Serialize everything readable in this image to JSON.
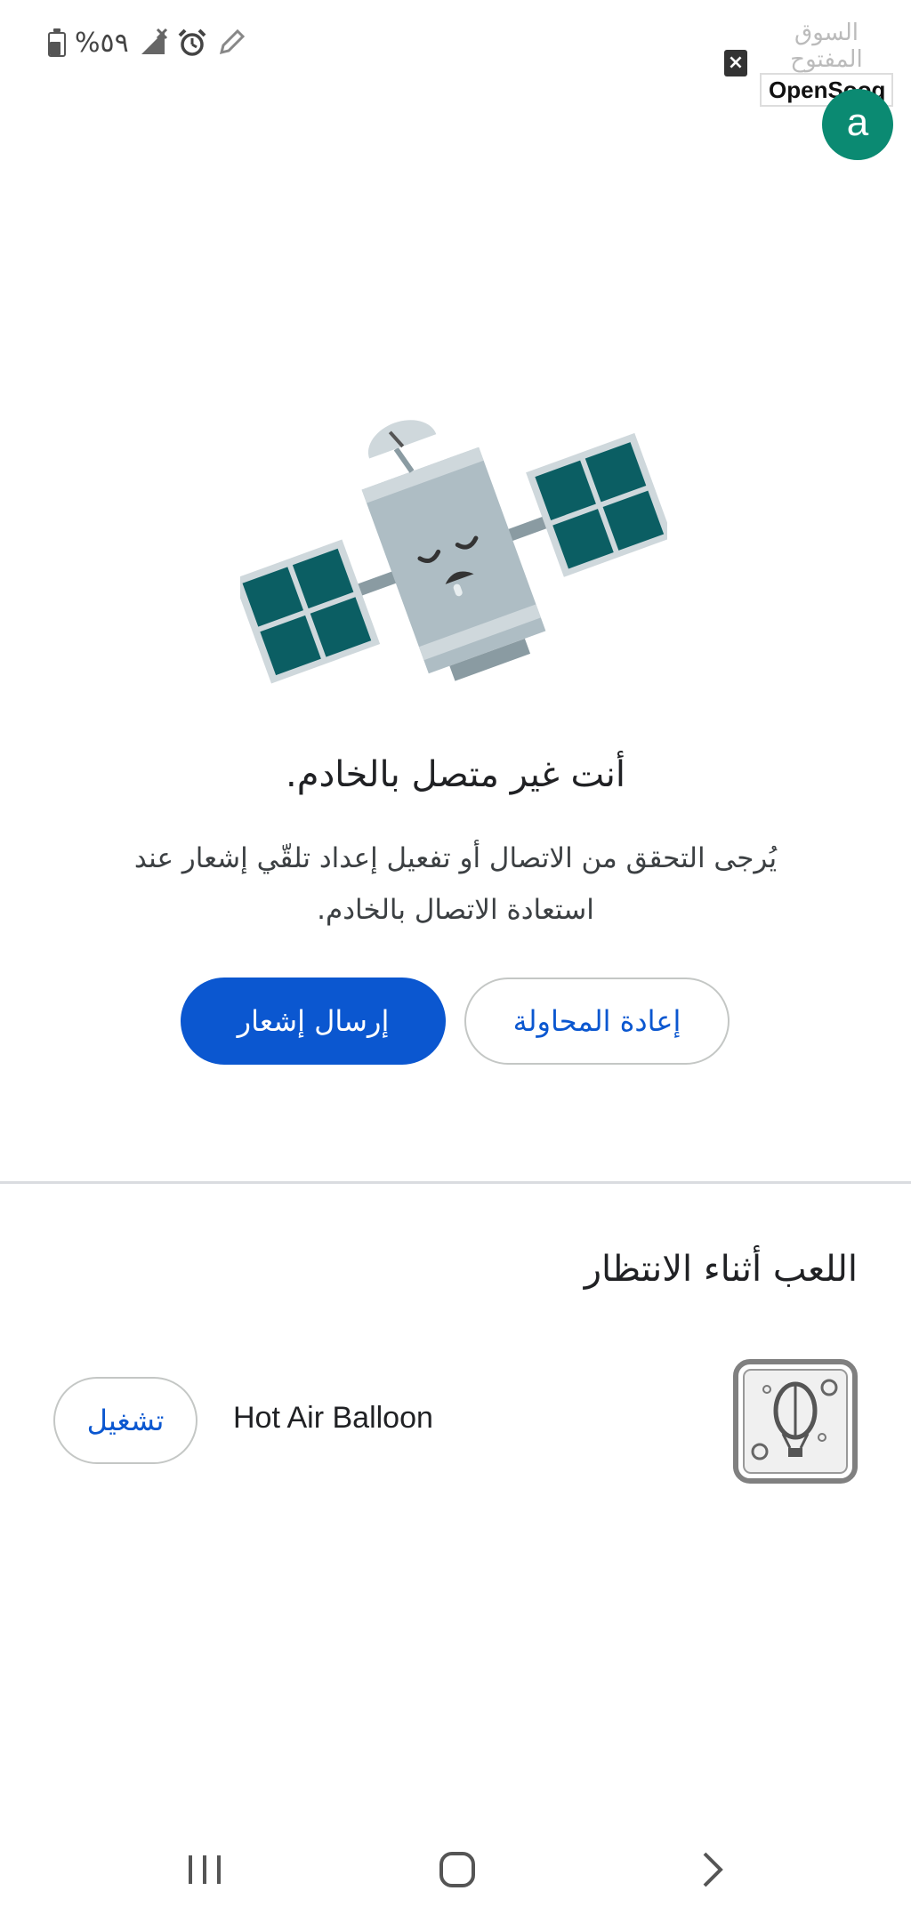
{
  "status_bar": {
    "battery_percent": "%٥٩",
    "watermark_arabic": "السوق المفتوح",
    "watermark_brand": "OpenSooq",
    "icons": [
      "battery-icon",
      "no-signal-icon",
      "alarm-icon",
      "edit-icon",
      "close-notification-icon"
    ]
  },
  "account": {
    "avatar_letter": "a",
    "avatar_color": "#0b8a72"
  },
  "offline": {
    "title": "أنت غير متصل بالخادم.",
    "description": "يُرجى التحقق من الاتصال أو تفعيل إعداد تلقّي إشعار عند استعادة الاتصال بالخادم.",
    "notify_button": "إرسال إشعار",
    "retry_button": "إعادة المحاولة",
    "illustration": "sleeping-satellite"
  },
  "games": {
    "section_title": "اللعب أثناء الانتظار",
    "items": [
      {
        "name": "Hot Air Balloon",
        "play_label": "تشغيل",
        "icon": "hot-air-balloon-icon"
      }
    ]
  },
  "nav_bar": {
    "items": [
      "recent-apps",
      "home",
      "back"
    ]
  },
  "colors": {
    "primary": "#0b57d0",
    "satellite_panel": "#0b5e63",
    "satellite_body": "#aebdc4"
  }
}
